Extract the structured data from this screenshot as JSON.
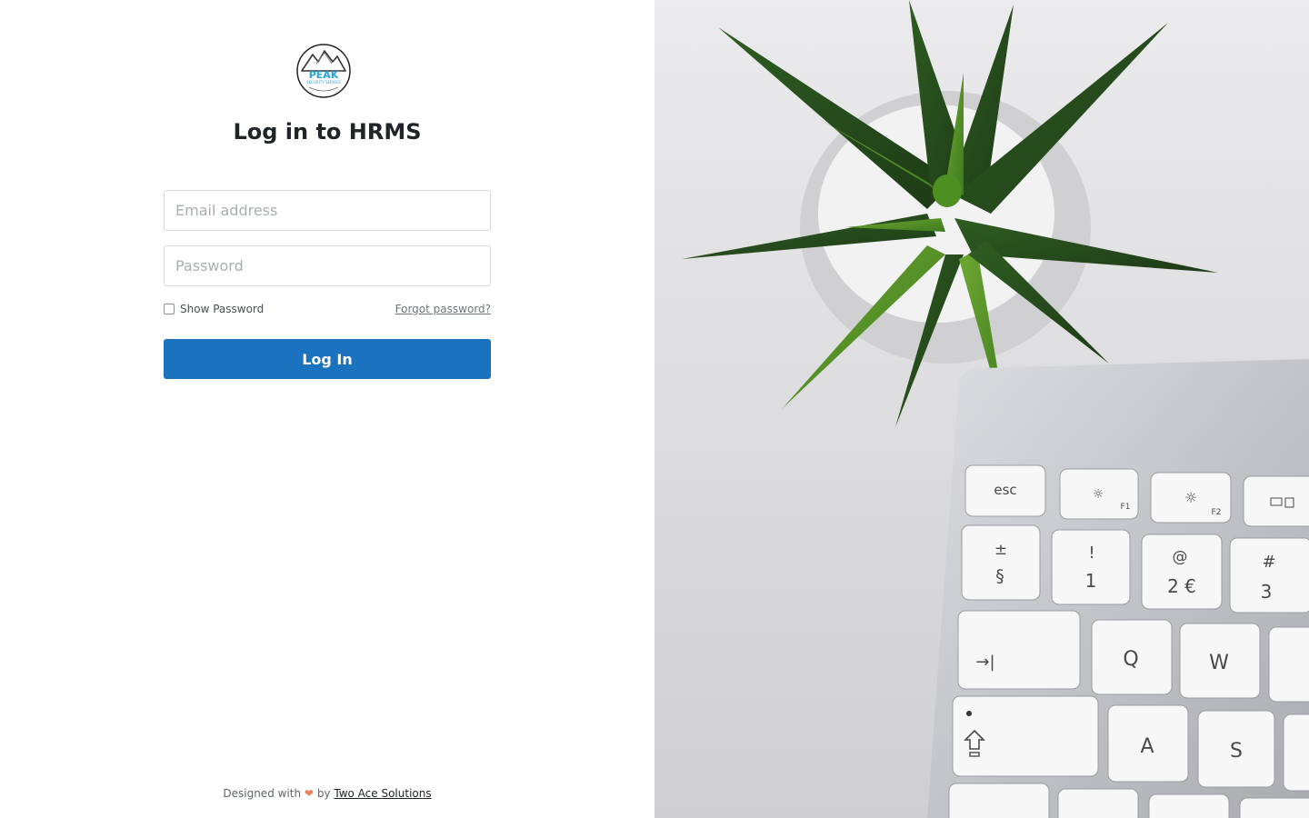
{
  "logo": {
    "name": "PEAK",
    "subtitle": "SECURITY SERVICE"
  },
  "page": {
    "title": "Log in to HRMS"
  },
  "form": {
    "email_placeholder": "Email address",
    "password_placeholder": "Password",
    "show_password_label": "Show Password",
    "show_password_checked": false,
    "forgot_password_label": "Forgot password?",
    "login_button_label": "Log In"
  },
  "footer": {
    "prefix": "Designed with",
    "heart": "❤",
    "by": "by",
    "brand": "Two Ace Solutions"
  },
  "keyboard": {
    "esc": "esc",
    "f1": "F1",
    "f2": "F2",
    "row1": [
      {
        "top": "±",
        "bottom": "§"
      },
      {
        "top": "!",
        "bottom": "1"
      },
      {
        "top": "@",
        "bottom": "2 €"
      },
      {
        "top": "#",
        "bottom": "3"
      }
    ],
    "tab": "→|",
    "q": "Q",
    "w": "W",
    "a": "A",
    "s": "S"
  },
  "colors": {
    "accent": "#1b72be",
    "heart": "#f07b58"
  }
}
